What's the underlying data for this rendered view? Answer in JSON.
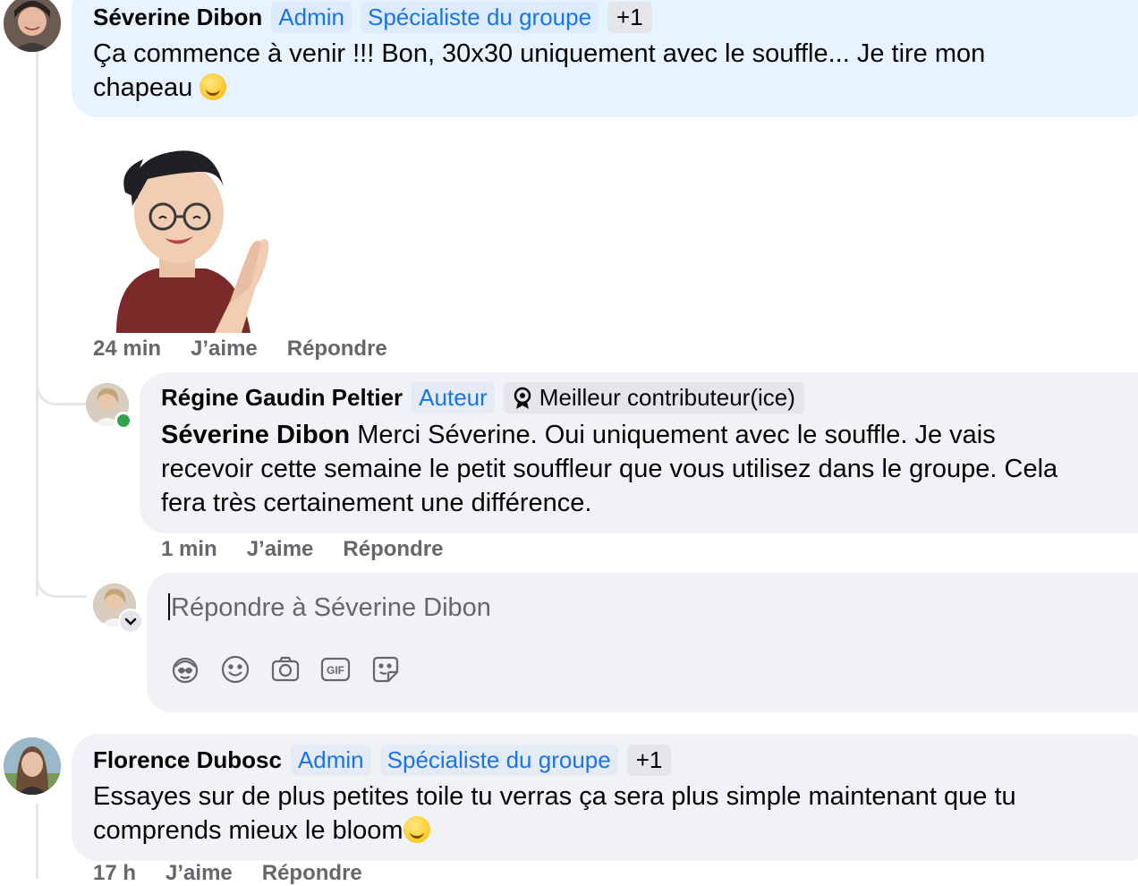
{
  "comments": [
    {
      "author": "Séverine Dibon",
      "badges": [
        "Admin",
        "Spécialiste du groupe"
      ],
      "extra_badge": "+1",
      "text_line1": "Ça commence à venir !!! Bon, 30x30 uniquement avec le souffle... Je tire mon",
      "text_line2": "chapeau",
      "emoji": "relieved-smile-emoji",
      "sticker": "applauding-avatar-sticker",
      "time": "24 min",
      "like_label": "J’aime",
      "reply_label": "Répondre"
    },
    {
      "author": "Régine Gaudin Peltier",
      "badges": [
        "Auteur"
      ],
      "contributor_badge": "Meilleur contributeur(ice)",
      "mention": "Séverine Dibon",
      "text_line1": "Merci Séverine. Oui uniquement avec le souffle. Je vais",
      "text_line2": "recevoir cette semaine le petit souffleur que vous utilisez dans le groupe. Cela",
      "text_line3": "fera très certainement une différence.",
      "time": "1 min",
      "like_label": "J’aime",
      "reply_label": "Répondre"
    },
    {
      "author": "Florence Dubosc",
      "badges": [
        "Admin",
        "Spécialiste du groupe"
      ],
      "extra_badge": "+1",
      "text_line1": "Essayes sur de plus petites toile tu verras ça sera plus simple maintenant que tu",
      "text_line2": "comprends mieux le bloom",
      "emoji": "grinning-emoji",
      "time": "17 h",
      "like_label": "J’aime",
      "reply_label": "Répondre"
    }
  ],
  "reply_box": {
    "placeholder": "Répondre à Séverine Dibon",
    "tools": [
      "avatar-sticker-icon",
      "emoji-icon",
      "camera-icon",
      "gif-icon",
      "sticker-icon"
    ]
  },
  "colors": {
    "blue_bubble": "#e7f3ff",
    "gray_bubble": "#f0f2f5",
    "accent": "#1b74e4",
    "secondary_text": "#65676b"
  }
}
